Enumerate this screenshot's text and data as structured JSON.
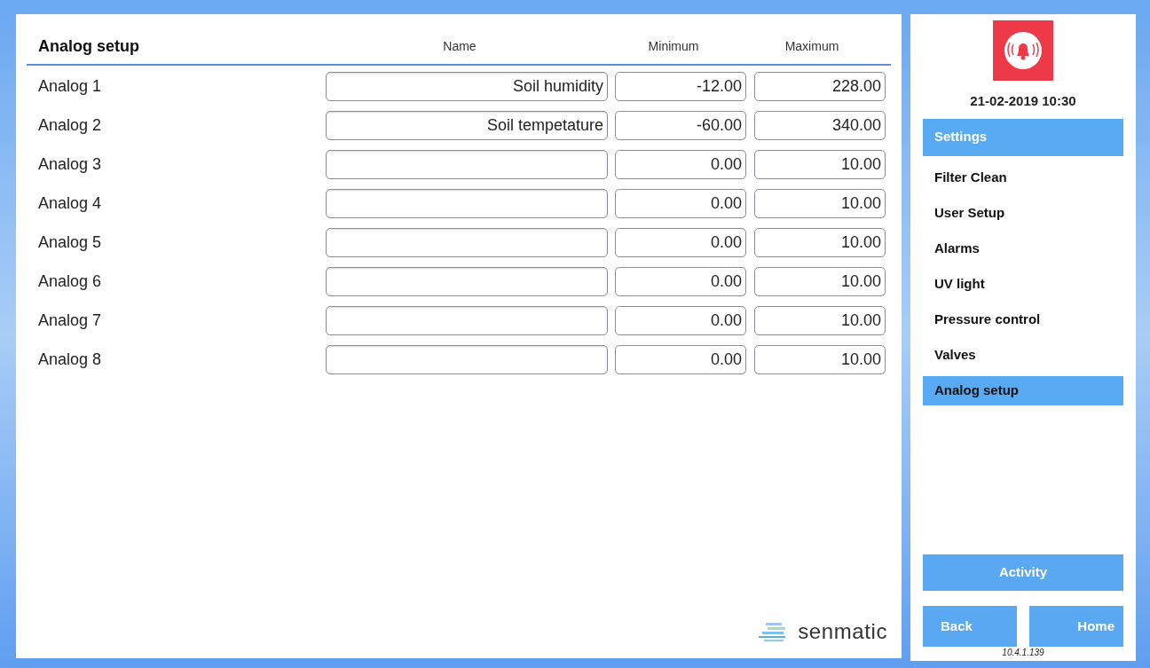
{
  "title": "Analog setup",
  "columns": [
    "Name",
    "Minimum",
    "Maximum"
  ],
  "rows": [
    {
      "label": "Analog 1",
      "name": "Soil humidity",
      "minimum": "-12.00",
      "maximum": "228.00"
    },
    {
      "label": "Analog 2",
      "name": "Soil tempetature",
      "minimum": "-60.00",
      "maximum": "340.00"
    },
    {
      "label": "Analog 3",
      "minimum": "0.00",
      "maximum": "10.00"
    },
    {
      "label": "Analog 4",
      "minimum": "0.00",
      "maximum": "10.00"
    },
    {
      "label": "Analog 5",
      "minimum": "0.00",
      "maximum": "10.00"
    },
    {
      "label": "Analog 6",
      "minimum": "0.00",
      "maximum": "10.00"
    },
    {
      "label": "Analog 7",
      "minimum": "0.00",
      "maximum": "10.00"
    },
    {
      "label": "Analog 8",
      "minimum": "0.00",
      "maximum": "10.00"
    }
  ],
  "brand": "senmatic",
  "sidebar": {
    "datetime": "21-02-2019 10:30",
    "section": "Settings",
    "items": [
      {
        "label": "Filter Clean",
        "selected": false
      },
      {
        "label": "User Setup",
        "selected": false
      },
      {
        "label": "Alarms",
        "selected": false
      },
      {
        "label": "UV light",
        "selected": false
      },
      {
        "label": "Pressure control",
        "selected": false
      },
      {
        "label": "Valves",
        "selected": false
      },
      {
        "label": "Analog setup",
        "selected": true
      }
    ],
    "activity": "Activity",
    "back": "Back",
    "home": "Home",
    "ip": "10.4.1.139"
  }
}
